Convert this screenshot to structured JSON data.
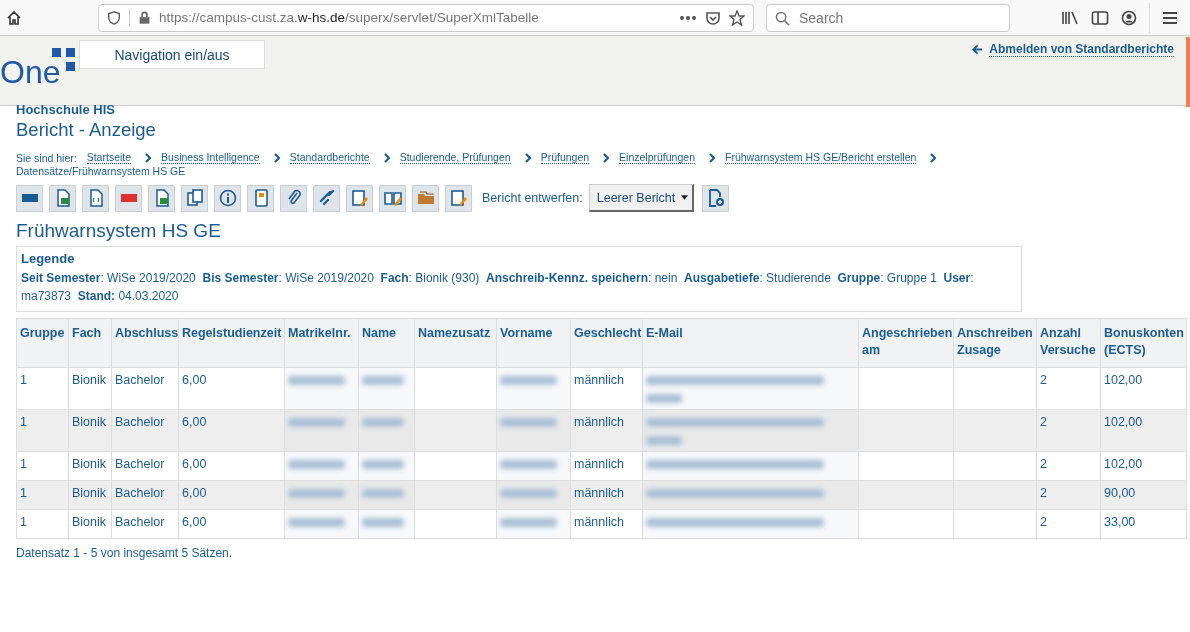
{
  "browser": {
    "url_pre": "https://campus-cust.za.",
    "url_host": "w-hs.de",
    "url_post": "/superx/servlet/SuperXmlTabelle",
    "search_placeholder": "Search"
  },
  "header": {
    "logo": "One",
    "nav_toggle": "Navigation ein/aus",
    "logout_link": "Abmelden von Standardberichte"
  },
  "institution": "Hochschule HIS",
  "page_title": "Bericht - Anzeige",
  "breadcrumb": {
    "label": "Sie sind hier:",
    "items": [
      "Startseite",
      "Business Intelligence",
      "Standardberichte",
      "Studierende, Prüfungen",
      "Prüfungen",
      "Einzelprüfungen",
      "Frühwarnsystem HS GE/Bericht erstellen"
    ],
    "current": "Datensätze/Frühwarnsystem HS GE"
  },
  "toolbar": {
    "design_label": "Bericht entwerfen:",
    "design_value": "Leerer Bericht"
  },
  "report_title": "Frühwarnsystem HS GE",
  "legend": {
    "title": "Legende",
    "text": "**Seit Semester**: WiSe 2019/2020  **Bis Semester**: WiSe 2019/2020  **Fach**: Bionik (930)  **Anschreib-Kennz. speichern**: nein  **Ausgabetiefe**: Studierende  **Gruppe**: Gruppe 1  **User**: ma73873  **Stand:** 04.03.2020"
  },
  "table": {
    "columns": [
      "Gruppe",
      "Fach",
      "Abschluss",
      "Regelstudienzeit",
      "Matrikelnr.",
      "Name",
      "Namezusatz",
      "Vorname",
      "Geschlecht",
      "E-Mail",
      "Angeschrieben am",
      "Anschreiben Zusage",
      "Anzahl Versuche",
      "Bonuskonten (ECTS)"
    ],
    "rows": [
      {
        "cells": [
          {
            "text": "1"
          },
          {
            "text": "Bionik"
          },
          {
            "text": "Bachelor"
          },
          {
            "text": "6,00"
          },
          {
            "blurred": true
          },
          {
            "blurred": true
          },
          {
            "text": ""
          },
          {
            "blurred": true
          },
          {
            "text": "männlich"
          },
          {
            "blurred": true,
            "wrapped": true
          },
          {
            "text": ""
          },
          {
            "text": ""
          },
          {
            "text": "2"
          },
          {
            "text": "102,00"
          }
        ]
      },
      {
        "cells": [
          {
            "text": "1"
          },
          {
            "text": "Bionik"
          },
          {
            "text": "Bachelor"
          },
          {
            "text": "6,00"
          },
          {
            "blurred": true
          },
          {
            "blurred": true
          },
          {
            "text": ""
          },
          {
            "blurred": true
          },
          {
            "text": "männlich"
          },
          {
            "blurred": true,
            "wrapped": true
          },
          {
            "text": ""
          },
          {
            "text": ""
          },
          {
            "text": "2"
          },
          {
            "text": "102,00"
          }
        ]
      },
      {
        "cells": [
          {
            "text": "1"
          },
          {
            "text": "Bionik"
          },
          {
            "text": "Bachelor"
          },
          {
            "text": "6,00"
          },
          {
            "blurred": true
          },
          {
            "blurred": true
          },
          {
            "text": ""
          },
          {
            "blurred": true
          },
          {
            "text": "männlich"
          },
          {
            "blurred": true
          },
          {
            "text": ""
          },
          {
            "text": ""
          },
          {
            "text": "2"
          },
          {
            "text": "102,00"
          }
        ]
      },
      {
        "cells": [
          {
            "text": "1"
          },
          {
            "text": "Bionik"
          },
          {
            "text": "Bachelor"
          },
          {
            "text": "6,00"
          },
          {
            "blurred": true
          },
          {
            "blurred": true
          },
          {
            "text": ""
          },
          {
            "blurred": true
          },
          {
            "text": "männlich"
          },
          {
            "blurred": true
          },
          {
            "text": ""
          },
          {
            "text": ""
          },
          {
            "text": "2"
          },
          {
            "text": "90,00"
          }
        ]
      },
      {
        "cells": [
          {
            "text": "1"
          },
          {
            "text": "Bionik"
          },
          {
            "text": "Bachelor"
          },
          {
            "text": "6,00"
          },
          {
            "blurred": true
          },
          {
            "blurred": true
          },
          {
            "text": ""
          },
          {
            "blurred": true
          },
          {
            "text": "männlich"
          },
          {
            "blurred": true
          },
          {
            "text": ""
          },
          {
            "text": ""
          },
          {
            "text": "2"
          },
          {
            "text": "33,00"
          }
        ]
      }
    ]
  },
  "footer": "Datensatz 1 - 5 von insgesamt 5 Sätzen."
}
